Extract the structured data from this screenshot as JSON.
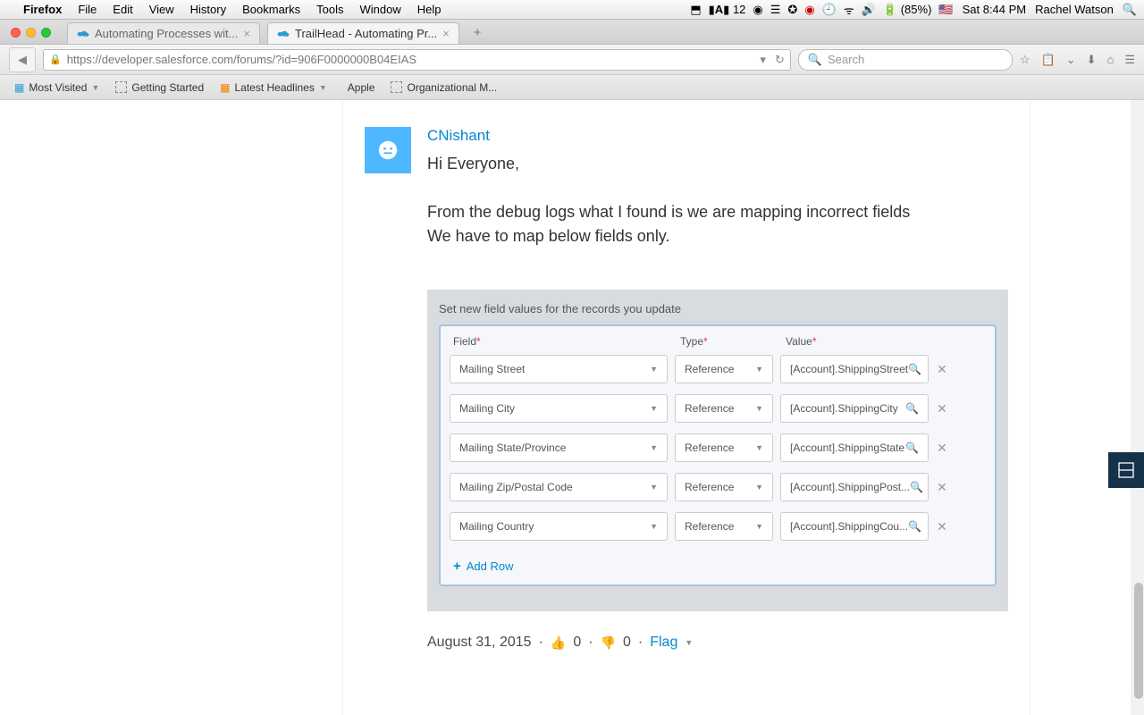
{
  "menubar": {
    "app": "Firefox",
    "items": [
      "File",
      "Edit",
      "View",
      "History",
      "Bookmarks",
      "Tools",
      "Window",
      "Help"
    ],
    "adobe": "12",
    "battery": "(85%)",
    "clock": "Sat 8:44 PM",
    "user": "Rachel Watson"
  },
  "tabs": [
    {
      "title": "Automating Processes wit...",
      "active": false
    },
    {
      "title": "TrailHead - Automating Pr...",
      "active": true
    }
  ],
  "url": "https://developer.salesforce.com/forums/?id=906F0000000B04EIAS",
  "search_placeholder": "Search",
  "bookmarks": [
    "Most Visited",
    "Getting Started",
    "Latest Headlines",
    "Apple",
    "Organizational M..."
  ],
  "post": {
    "author": "CNishant",
    "line1": "Hi Everyone,",
    "line2": "From the debug logs what I found is we are mapping incorrect fields",
    "line3": "We have to map below fields only."
  },
  "editor": {
    "title": "Set new field values for the records you update",
    "headers": [
      "Field",
      "Type",
      "Value"
    ],
    "rows": [
      {
        "field": "Mailing Street",
        "type": "Reference",
        "value": "[Account].ShippingStreet"
      },
      {
        "field": "Mailing City",
        "type": "Reference",
        "value": "[Account].ShippingCity"
      },
      {
        "field": "Mailing State/Province",
        "type": "Reference",
        "value": "[Account].ShippingState"
      },
      {
        "field": "Mailing Zip/Postal Code",
        "type": "Reference",
        "value": "[Account].ShippingPost..."
      },
      {
        "field": "Mailing Country",
        "type": "Reference",
        "value": "[Account].ShippingCou..."
      }
    ],
    "addrow": "Add Row"
  },
  "meta": {
    "date": "August 31, 2015",
    "up": "0",
    "down": "0",
    "flag": "Flag"
  }
}
